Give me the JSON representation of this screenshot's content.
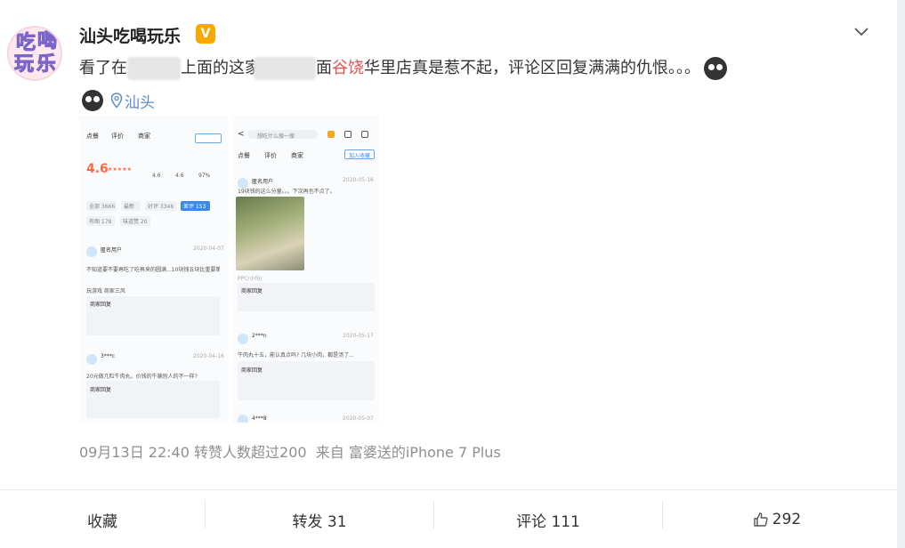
{
  "post": {
    "author": "汕头吃喝玩乐",
    "verified_badge": "V",
    "avatar_text": [
      "吃",
      "喝",
      "玩",
      "乐"
    ],
    "text_prefix": "看了在",
    "text_mid1": "上面的这家",
    "text_mid2": "面",
    "text_highlight": "谷饶",
    "text_suffix": "华里店真是惹不起，评论区回复满满的仇恨。。。",
    "location": "汕头",
    "timestamp": "09月13日 22:40",
    "repost_info": "转赞人数超过200",
    "source_prefix": "来自",
    "source": "富婆送的iPhone 7 Plus"
  },
  "screenshot1": {
    "tabs": [
      "点餐",
      "评价",
      "商家"
    ],
    "rating": "4.6",
    "filters": [
      "全部 3666",
      "最新",
      "好评 3346",
      "差评 153",
      "有图 178",
      "味道赞 20"
    ],
    "user": "匿名用户",
    "date1": "2020-04-07",
    "reply_title": "商家回复",
    "user2": "3***c",
    "date2": "2020-04-16",
    "comment2": "20元做几粒牛肉丸，价钱的牛腩别人的不一样?",
    "reply_title2": "商家回复"
  },
  "screenshot2": {
    "search_placeholder": "想吃什么搜一搜",
    "tabs": [
      "点餐",
      "评价",
      "商家"
    ],
    "follow": "加入收藏",
    "user": "匿名用户",
    "date1": "2020-05-16",
    "comment1": "19块钱的这么分量。。。下次再也不点了。",
    "reply_title": "商家回复",
    "user2": "2***n",
    "date2": "2020-05-17",
    "comment2": "牛肉丸十五，能认真点吗? 几块小肉，都是汤了...",
    "reply_title2": "商家回复",
    "user3": "4***8",
    "date3": "2020-05-07"
  },
  "actions": {
    "favorite": "收藏",
    "repost": "转发 31",
    "comment": "评论 111",
    "like": "292"
  }
}
